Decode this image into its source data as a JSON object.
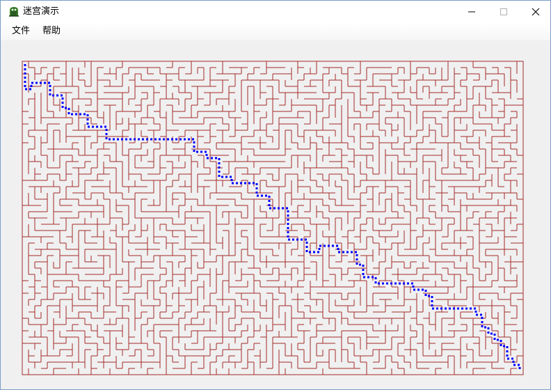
{
  "window": {
    "title": "迷宫演示",
    "icon": "app-maze-icon"
  },
  "titlebar_buttons": {
    "minimize": "minimize-icon",
    "maximize": "maximize-icon",
    "close": "close-icon"
  },
  "menu": {
    "items": [
      {
        "label": "文件"
      },
      {
        "label": "帮助"
      }
    ]
  },
  "maze": {
    "wall_color": "#a52a2a",
    "path_color": "#0000ff",
    "path_style": "dotted",
    "columns": 80,
    "rows": 50
  }
}
